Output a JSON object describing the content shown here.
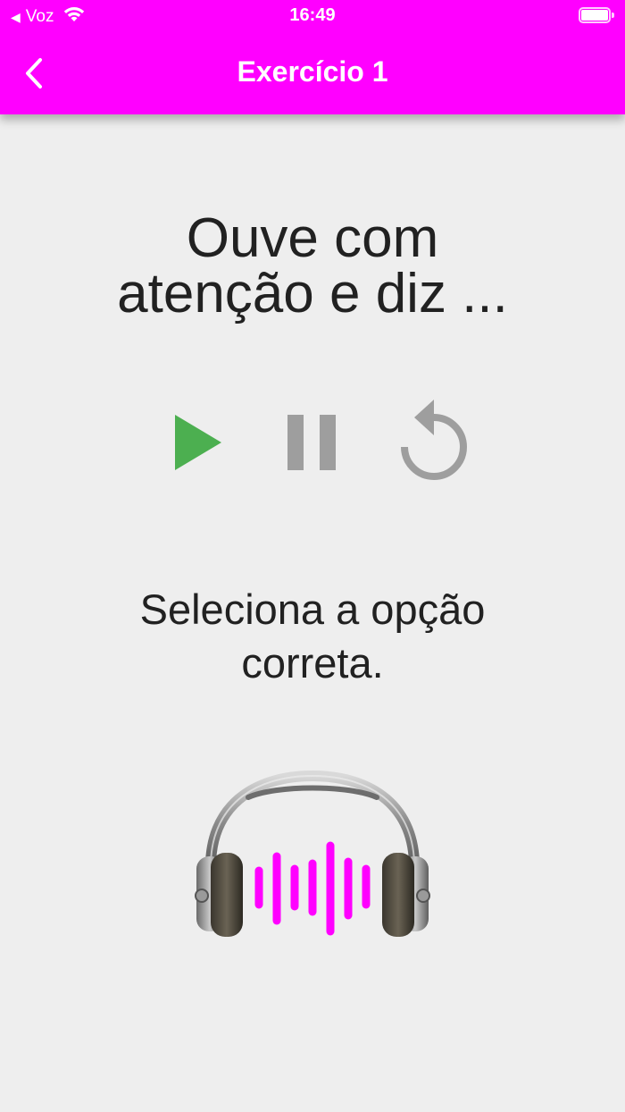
{
  "status_bar": {
    "carrier": "Voz",
    "time": "16:49"
  },
  "nav": {
    "title": "Exercício 1",
    "back_icon": "chevron-left-icon"
  },
  "instruction": {
    "line1": "Ouve com",
    "line2": "atenção e diz ..."
  },
  "controls": {
    "play_icon": "play-icon",
    "pause_icon": "pause-icon",
    "replay_icon": "replay-icon",
    "play_color": "#4caf50",
    "inactive_color": "#9e9e9e"
  },
  "prompt": {
    "line1": "Seleciona a opção",
    "line2": "correta."
  },
  "illustration": {
    "icon": "headphones-soundwave-icon",
    "accent_color": "#ff00ff"
  },
  "theme": {
    "header_color": "#ff00ff",
    "background": "#eeeeee"
  }
}
